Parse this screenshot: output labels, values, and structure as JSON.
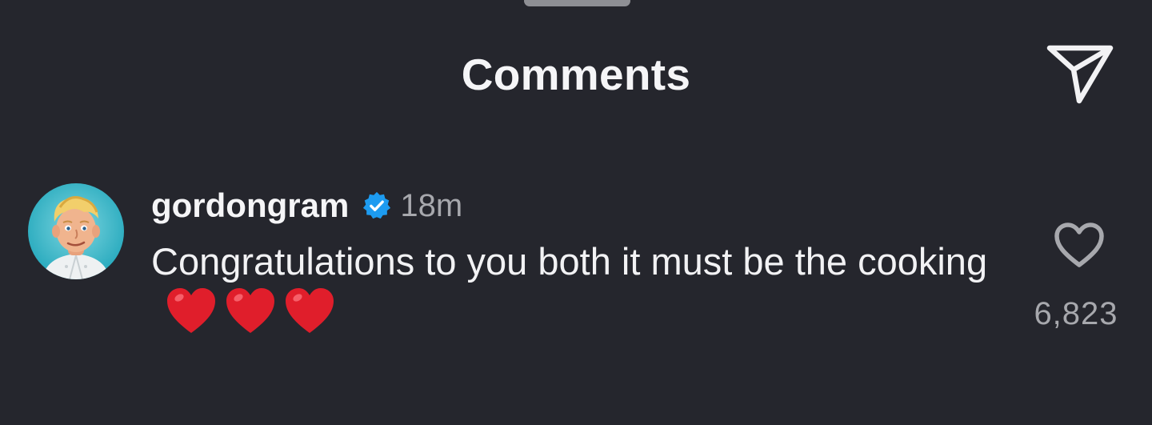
{
  "sheet": {
    "title": "Comments"
  },
  "icons": {
    "share": "paper-plane-icon",
    "verified": "verified-badge-icon",
    "like": "heart-outline-icon",
    "emoji": "red-heart-emoji"
  },
  "colors": {
    "background": "#25262d",
    "text_primary": "#f2f2f4",
    "text_secondary": "#a7a8ad",
    "verified_blue": "#1d9bf0",
    "heart_red": "#e01e2b"
  },
  "comment": {
    "username": "gordongram",
    "verified": true,
    "timestamp": "18m",
    "text": "Congratulations to you both it must be the cooking",
    "emoji_count": 3,
    "like_count": "6,823"
  }
}
